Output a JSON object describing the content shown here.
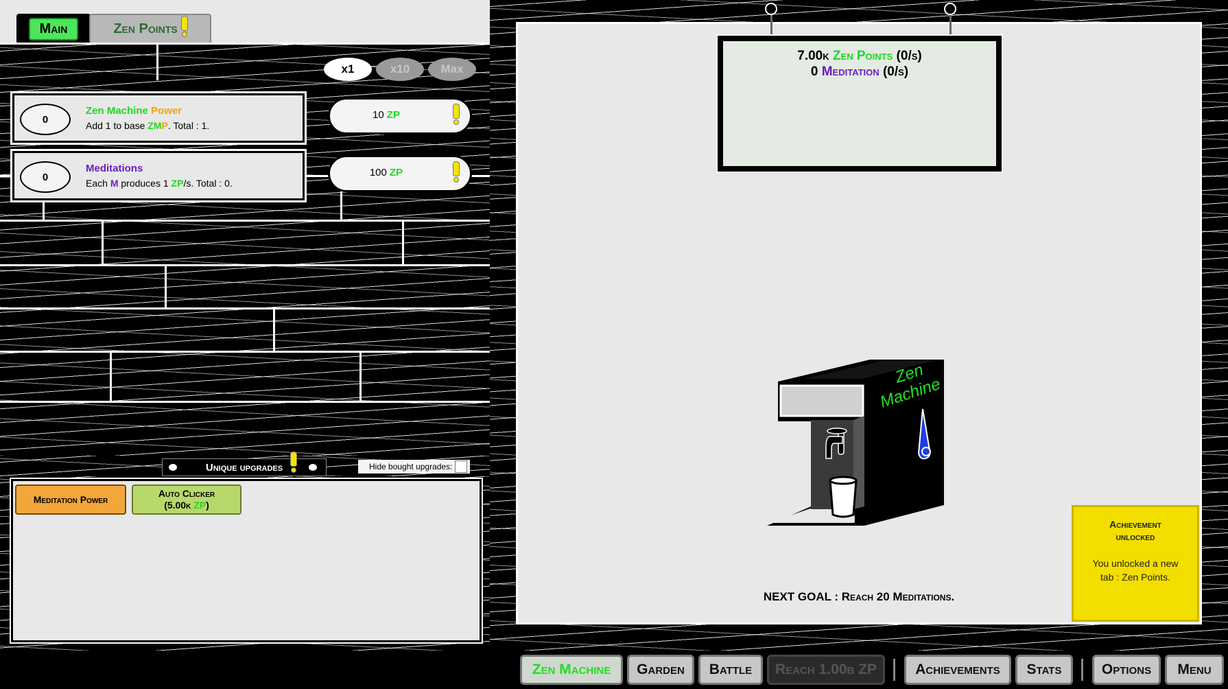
{
  "tabs": {
    "main_label": "Main",
    "zen_points_label": "Zen Points"
  },
  "multiplier": {
    "x1": "x1",
    "x10": "x10",
    "max": "Max",
    "selected": "x1"
  },
  "upgrades": [
    {
      "level": "0",
      "name_part1": "Zen Machine",
      "name_part2": " Power",
      "desc_a": "Add 1 to base ",
      "desc_zm": "ZM",
      "desc_p": "P",
      "desc_b": ". Total : 1.",
      "cost_value": "10",
      "cost_unit": "ZP"
    },
    {
      "level": "0",
      "name": "Meditations",
      "desc_a": "Each ",
      "desc_m": "M",
      "desc_b": " produces 1 ",
      "desc_zp": "ZP",
      "desc_c": "/s. Total : 0.",
      "cost_value": "100",
      "cost_unit": "ZP"
    }
  ],
  "unique": {
    "label": "Unique upgrades",
    "hide_bought": "Hide bought upgrades:",
    "hide_bought_checked": false,
    "meditation_power": "Meditation Power",
    "auto_clicker_line1": "Auto Clicker",
    "auto_clicker_open": "(5.00k ",
    "auto_clicker_unit": "ZP",
    "auto_clicker_close": ")"
  },
  "stats": {
    "zen_points_value": "7.00k",
    "zen_points_label": "Zen Points",
    "zen_points_rate": "(0/s)",
    "meditation_value": "0",
    "meditation_label": "Meditation",
    "meditation_rate": "(0/s)"
  },
  "machine": {
    "label_line1": "Zen",
    "label_line2": "Machine"
  },
  "goal": "NEXT GOAL : Reach 20 Meditations.",
  "achievement": {
    "title_line1": "Achievement",
    "title_line2": "unlocked",
    "message_line1": "You unlocked a new",
    "message_line2": "tab : Zen Points."
  },
  "nav": {
    "zen_machine": "Zen Machine",
    "garden": "Garden",
    "battle": "Battle",
    "locked": "Reach 1.00b ZP",
    "achievements": "Achievements",
    "stats": "Stats",
    "options": "Options",
    "menu": "Menu"
  },
  "colors": {
    "zen_green": "#1fd81f",
    "power_orange": "#f0a500",
    "meditation_purple": "#6a1fc0",
    "alert_yellow": "#f2e500",
    "achievement_bg": "#f2df00"
  }
}
